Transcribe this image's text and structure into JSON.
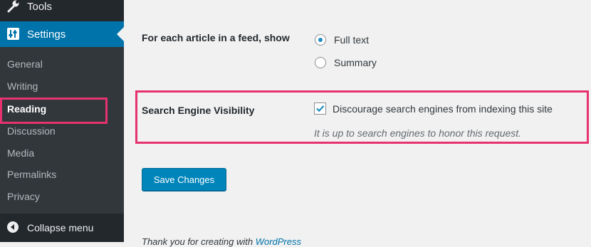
{
  "sidebar": {
    "tools_label": "Tools",
    "settings_label": "Settings",
    "submenu": [
      {
        "label": "General"
      },
      {
        "label": "Writing"
      },
      {
        "label": "Reading"
      },
      {
        "label": "Discussion"
      },
      {
        "label": "Media"
      },
      {
        "label": "Permalinks"
      },
      {
        "label": "Privacy"
      }
    ],
    "current_item": "Reading",
    "collapse_label": "Collapse menu"
  },
  "feed_setting": {
    "label": "For each article in a feed, show",
    "options": [
      {
        "label": "Full text",
        "checked": true
      },
      {
        "label": "Summary",
        "checked": false
      }
    ]
  },
  "search_visibility": {
    "label": "Search Engine Visibility",
    "checkbox_label": "Discourage search engines from indexing this site",
    "checked": true,
    "description": "It is up to search engines to honor this request."
  },
  "save_button_label": "Save Changes",
  "footer": {
    "text": "Thank you for creating with",
    "link": "WordPress"
  },
  "colors": {
    "sidebar_bg": "#23282d",
    "submenu_bg": "#32373c",
    "accent": "#0073aa",
    "highlight": "#e6326e",
    "button": "#0085ba"
  }
}
